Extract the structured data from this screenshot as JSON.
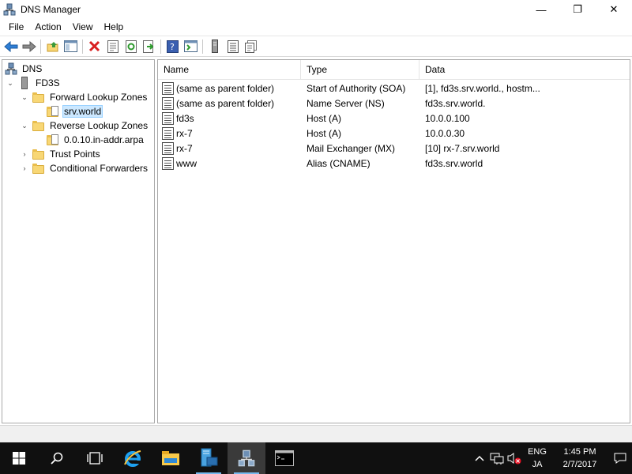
{
  "window": {
    "title": "DNS Manager",
    "minimize": "—",
    "maximize": "❐",
    "close": "✕"
  },
  "menu": [
    "File",
    "Action",
    "View",
    "Help"
  ],
  "toolbar": {
    "icons": [
      "back-icon",
      "forward-icon",
      "up-folder-icon",
      "show-hide-tree-icon",
      "delete-icon",
      "properties-icon",
      "refresh-icon",
      "export-list-icon",
      "help-icon",
      "show-hide-action-pane-icon",
      "server-icon",
      "list-icon",
      "detail-icon"
    ]
  },
  "tree": {
    "root": "DNS",
    "server": "FD3S",
    "forward_zones": "Forward Lookup Zones",
    "forward_zone_item": "srv.world",
    "reverse_zones": "Reverse Lookup Zones",
    "reverse_zone_item": "0.0.10.in-addr.arpa",
    "trust_points": "Trust Points",
    "conditional_forwarders": "Conditional Forwarders"
  },
  "list": {
    "columns": [
      "Name",
      "Type",
      "Data"
    ],
    "rows": [
      {
        "name": "(same as parent folder)",
        "type": "Start of Authority (SOA)",
        "data": "[1], fd3s.srv.world., hostm..."
      },
      {
        "name": "(same as parent folder)",
        "type": "Name Server (NS)",
        "data": "fd3s.srv.world."
      },
      {
        "name": "fd3s",
        "type": "Host (A)",
        "data": "10.0.0.100"
      },
      {
        "name": "rx-7",
        "type": "Host (A)",
        "data": "10.0.0.30"
      },
      {
        "name": "rx-7",
        "type": "Mail Exchanger (MX)",
        "data": "[10]  rx-7.srv.world"
      },
      {
        "name": "www",
        "type": "Alias (CNAME)",
        "data": "fd3s.srv.world"
      }
    ]
  },
  "taskbar": {
    "lang_top": "ENG",
    "lang_bottom": "JA",
    "time": "1:45 PM",
    "date": "2/7/2017"
  },
  "colors": {
    "accent": "#0078d7",
    "selection": "#cce8ff",
    "taskbar": "#101010"
  }
}
